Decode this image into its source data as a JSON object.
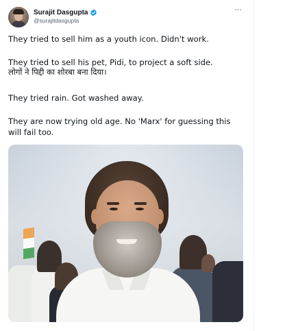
{
  "author": {
    "display_name": "Surajit Dasgupta",
    "handle": "@surajitdasgupta",
    "verified": true
  },
  "menu": {
    "more_label": "···"
  },
  "tweet": {
    "paragraph_1": "They tried to sell him as a youth icon. Didn't work.",
    "paragraph_2_line_1": "They tried to sell his pet, Pidi, to project a soft side.",
    "paragraph_2_line_2": "लोगों ने पिद्दी का शोरबा बना दिया।",
    "paragraph_3": "They tried rain. Got washed away.",
    "paragraph_4_line_1": "They are now trying old age. No 'Marx' for guessing this",
    "paragraph_4_line_2": "will fail too."
  },
  "media": {
    "type": "photo"
  },
  "colors": {
    "text_primary": "#0f1419",
    "text_secondary": "#536471",
    "verified_blue": "#1d9bf0"
  }
}
